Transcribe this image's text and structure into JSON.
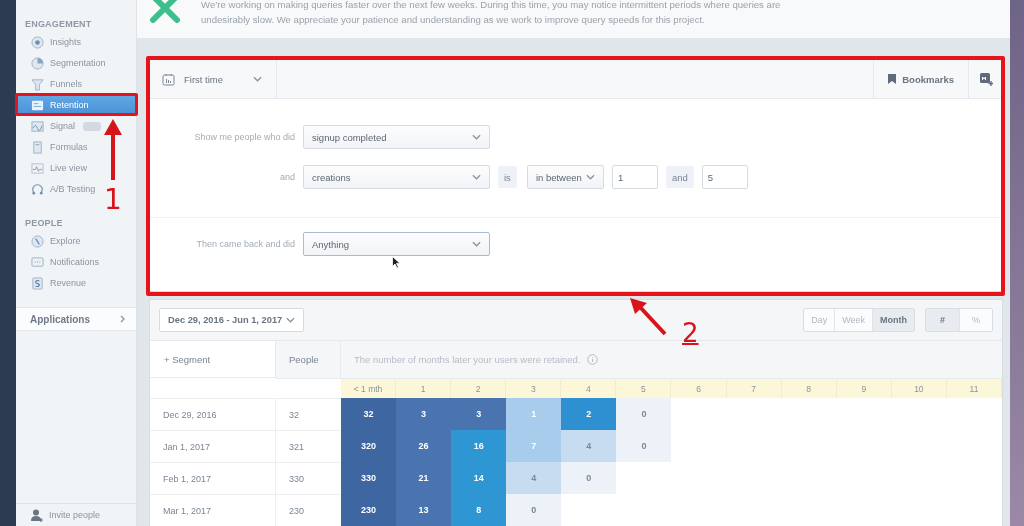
{
  "notice": {
    "text": "We’re working on making queries faster over the next few weeks. During this time, you may notice intermittent periods where queries are undesirably slow. We appreciate your patience and understanding as we work to improve query speeds for this project."
  },
  "sidebar": {
    "sections": [
      {
        "title": "ENGAGEMENT",
        "items": [
          {
            "label": "Insights",
            "selected": false,
            "badge": false
          },
          {
            "label": "Segmentation",
            "selected": false,
            "badge": false
          },
          {
            "label": "Funnels",
            "selected": false,
            "badge": false
          },
          {
            "label": "Retention",
            "selected": true,
            "badge": false
          },
          {
            "label": "Signal",
            "selected": false,
            "badge": true
          },
          {
            "label": "Formulas",
            "selected": false,
            "badge": false
          },
          {
            "label": "Live view",
            "selected": false,
            "badge": false
          },
          {
            "label": "A/B Testing",
            "selected": false,
            "badge": false
          }
        ]
      },
      {
        "title": "PEOPLE",
        "items": [
          {
            "label": "Explore",
            "selected": false,
            "badge": false
          },
          {
            "label": "Notifications",
            "selected": false,
            "badge": false
          },
          {
            "label": "Revenue",
            "selected": false,
            "badge": false
          }
        ]
      }
    ],
    "applications": "Applications",
    "invite": "Invite people"
  },
  "query": {
    "mode": "First time",
    "bookmarks": "Bookmarks",
    "event_row": {
      "label": "Show me people who did",
      "value": "signup completed"
    },
    "filter_row": {
      "label": "and",
      "property": "creations",
      "is_word": "is",
      "operator": "in between",
      "from": "1",
      "and_word": "and",
      "to": "5"
    },
    "return_row": {
      "label": "Then came back and did",
      "value": "Anything"
    }
  },
  "table": {
    "date_range": "Dec 29, 2016 - Jun 1, 2017",
    "units": [
      {
        "label": "Day",
        "selected": false
      },
      {
        "label": "Week",
        "selected": false
      },
      {
        "label": "Month",
        "selected": true
      }
    ],
    "formats": [
      {
        "label": "#",
        "selected": true
      },
      {
        "label": "%",
        "selected": false
      }
    ],
    "segment": "+ Segment",
    "people": "People",
    "note": "The number of months later your users were retained.",
    "columns": [
      "< 1 mth",
      "1",
      "2",
      "3",
      "4",
      "5",
      "6",
      "7",
      "8",
      "9",
      "10",
      "11"
    ],
    "rows": [
      {
        "date": "Dec 29, 2016",
        "people": "32",
        "cells": [
          {
            "value": "32",
            "color": "#3e66a0"
          },
          {
            "value": "3",
            "color": "#4a74b0"
          },
          {
            "value": "3",
            "color": "#4a74b0"
          },
          {
            "value": "1",
            "color": "#a8cdec"
          },
          {
            "value": "2",
            "color": "#2e8fd1"
          },
          {
            "value": "0",
            "color": "#edf2f8"
          }
        ]
      },
      {
        "date": "Jan 1, 2017",
        "people": "321",
        "cells": [
          {
            "value": "320",
            "color": "#3e66a0"
          },
          {
            "value": "26",
            "color": "#4a74b0"
          },
          {
            "value": "16",
            "color": "#2f96d4"
          },
          {
            "value": "7",
            "color": "#a8cdec"
          },
          {
            "value": "4",
            "color": "#c6dcf0"
          },
          {
            "value": "0",
            "color": "#edf2f8"
          }
        ]
      },
      {
        "date": "Feb 1, 2017",
        "people": "330",
        "cells": [
          {
            "value": "330",
            "color": "#3e66a0"
          },
          {
            "value": "21",
            "color": "#4a74b0"
          },
          {
            "value": "14",
            "color": "#2f96d4"
          },
          {
            "value": "4",
            "color": "#c6dcf0"
          },
          {
            "value": "0",
            "color": "#edf2f8"
          }
        ]
      },
      {
        "date": "Mar 1, 2017",
        "people": "230",
        "cells": [
          {
            "value": "230",
            "color": "#3e66a0"
          },
          {
            "value": "13",
            "color": "#4a74b0"
          },
          {
            "value": "8",
            "color": "#2f96d4"
          },
          {
            "value": "0",
            "color": "#edf2f8"
          }
        ]
      }
    ]
  },
  "annotations": [
    {
      "label": "1"
    },
    {
      "label": "2"
    }
  ]
}
